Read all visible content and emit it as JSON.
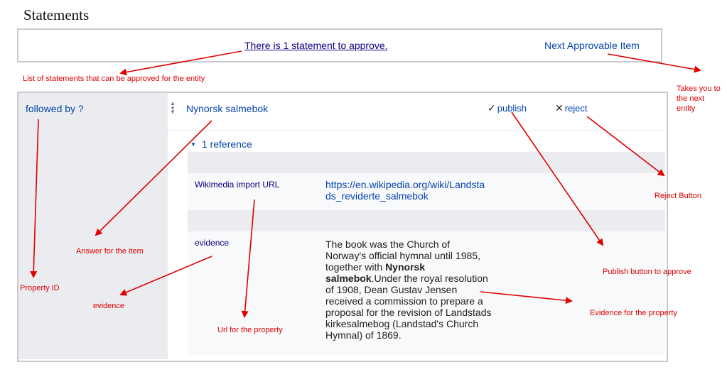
{
  "page": {
    "title": "Statements"
  },
  "approval_bar": {
    "approve_text": "There is 1 statement to approve.",
    "next_item": "Next Approvable Item"
  },
  "statement": {
    "property": "followed by ?",
    "value": "Nynorsk salmebok",
    "publish_label": "publish",
    "reject_label": "reject",
    "references_toggle": "1 reference",
    "references": [
      {
        "property": "Wikimedia import URL",
        "value": "https://en.wikipedia.org/wiki/Landstads_reviderte_salmebok"
      },
      {
        "property": "evidence",
        "value_pre": "The book was the Church of Norway's official hymnal until 1985, together with ",
        "value_bold": "Nynorsk salmebok",
        "value_post": ".Under the royal resolution of 1908, Dean Gustav Jensen received a commission to prepare a proposal for the revision of Landstads kirkesalmebog (Landstad's Church Hymnal) of 1869."
      }
    ]
  },
  "annotations": {
    "list": "List of statements that can be approved for the entity",
    "next_entity_1": "Takes you to",
    "next_entity_2": "the next",
    "next_entity_3": "entity",
    "reject": "Reject Button",
    "answer": "Answer for the item",
    "publish": "Publish button to approve",
    "property_id": "Property ID",
    "evidence": "evidence",
    "evidence_property": "Evidence for the property",
    "url_property": "Url for the property"
  },
  "colors": {
    "link": "#0645ad",
    "annotation": "#e00000",
    "panel_grey": "#eaecf0",
    "border": "#c8ccd1"
  },
  "icons": {
    "rank": "rank-normal-icon",
    "publish": "checkmark-icon",
    "reject": "close-icon",
    "toggle": "triangle-down-icon"
  }
}
